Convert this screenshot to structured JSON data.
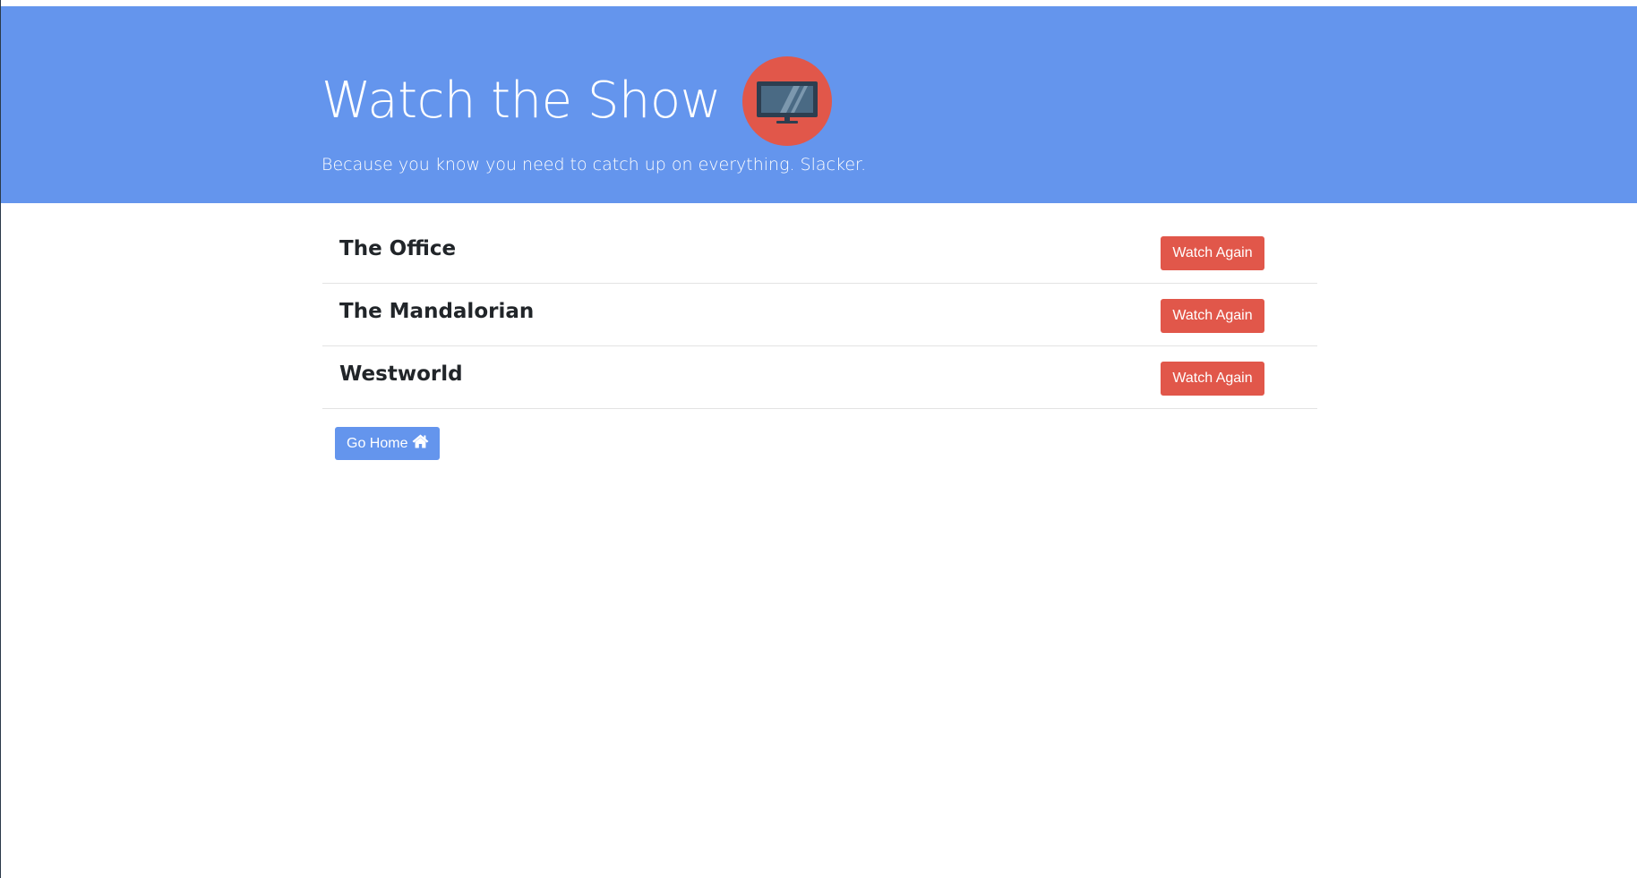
{
  "header": {
    "title": "Watch the Show",
    "subtitle": "Because you know you need to catch up on everything. Slacker.",
    "logo_icon": "television-icon"
  },
  "shows": [
    {
      "title": "The Office",
      "action_label": "Watch Again"
    },
    {
      "title": "The Mandalorian",
      "action_label": "Watch Again"
    },
    {
      "title": "Westworld",
      "action_label": "Watch Again"
    }
  ],
  "footer": {
    "home_label": "Go Home",
    "home_icon": "home-icon"
  },
  "colors": {
    "primary": "#6495ED",
    "accent": "#E1574A",
    "text_dark": "#212529"
  }
}
